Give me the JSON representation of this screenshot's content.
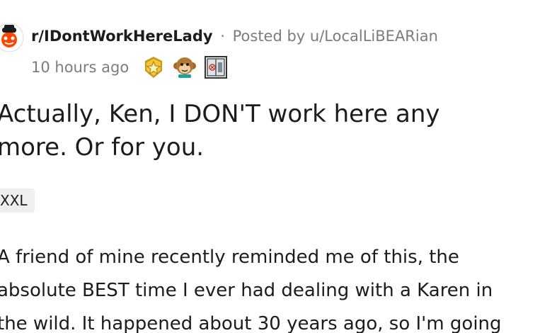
{
  "header": {
    "subreddit": "r/IDontWorkHereLady",
    "separator": "·",
    "posted_by_prefix": "Posted by",
    "username": "u/LocalLiBEARian",
    "time_ago": "10 hours ago"
  },
  "awards": [
    {
      "icon": "gold-star-award-icon"
    },
    {
      "icon": "monkey-award-icon"
    },
    {
      "icon": "window-award-icon"
    }
  ],
  "post": {
    "title_line_1": "Actually, Ken, I DON'T work here any",
    "title_line_2": "more. Or for you.",
    "flair": "XXL",
    "body_line_1": "A friend of mine recently reminded me of this, the",
    "body_line_2": "absolute BEST time I ever had dealing with a Karen in",
    "body_line_3": "the wild. It happened about 30 years ago, so I'm going"
  },
  "colors": {
    "text": "#1c1c1c",
    "meta": "#7c7c7c",
    "flair_bg": "#edeff1",
    "avatar_red": "#ff4500"
  }
}
